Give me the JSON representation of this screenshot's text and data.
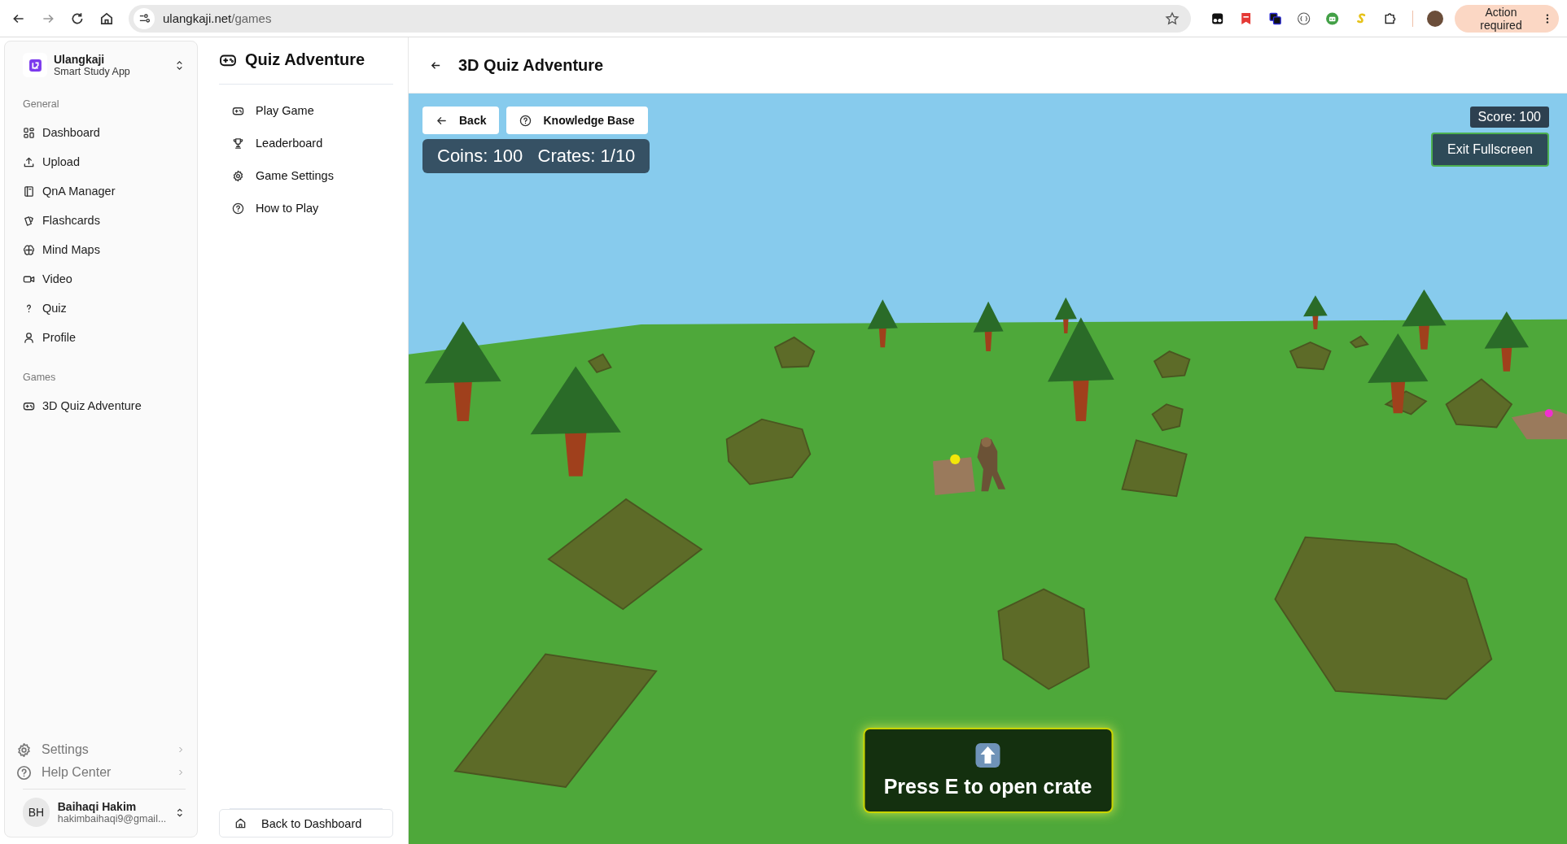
{
  "browser": {
    "url_host": "ulangkaji.net",
    "url_path": "/games",
    "action_button": "Action required"
  },
  "sidebar": {
    "app_name": "Ulangkaji",
    "app_subtitle": "Smart Study App",
    "sections": [
      {
        "heading": "General",
        "items": [
          "Dashboard",
          "Upload",
          "QnA Manager",
          "Flashcards",
          "Mind Maps",
          "Video",
          "Quiz",
          "Profile"
        ]
      },
      {
        "heading": "Games",
        "items": [
          "3D Quiz Adventure"
        ]
      }
    ],
    "footer_items": [
      "Settings",
      "Help Center"
    ],
    "user": {
      "initials": "BH",
      "name": "Baihaqi Hakim",
      "email": "hakimbaihaqi9@gmail..."
    }
  },
  "game_menu": {
    "title": "Quiz Adventure",
    "items": [
      "Play Game",
      "Leaderboard",
      "Game Settings",
      "How to Play"
    ],
    "back_button": "Back to Dashboard"
  },
  "main": {
    "title": "3D Quiz Adventure",
    "hud": {
      "back_button": "Back",
      "knowledge_button": "Knowledge Base",
      "stats": "Coins: 100   Crates: 1/10",
      "score": "Score: 100",
      "exit_button": "Exit Fullscreen"
    },
    "prompt": "Press E to open crate"
  }
}
